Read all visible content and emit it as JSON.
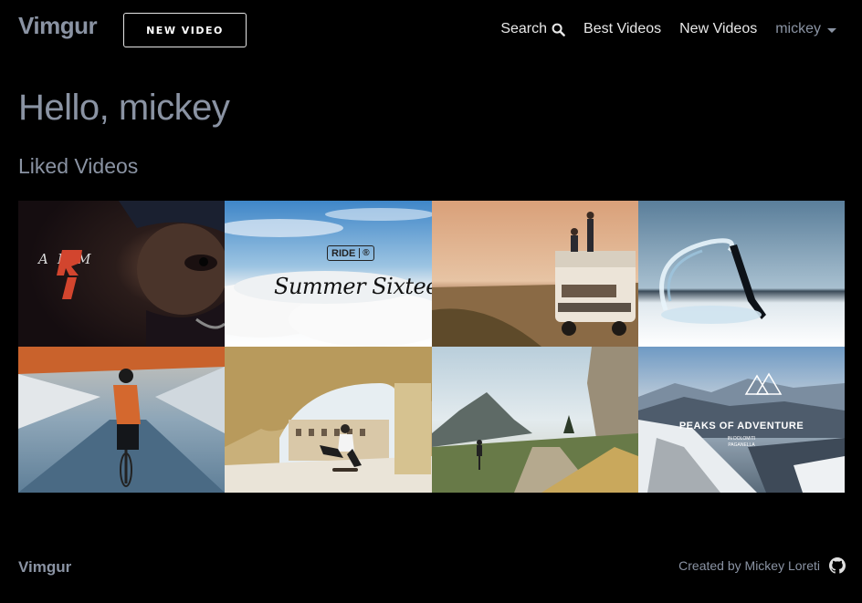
{
  "navbar": {
    "brand": "Vimgur",
    "new_video_label": "NEW VIDEO",
    "links": {
      "search": "Search",
      "best": "Best Videos",
      "new": "New Videos",
      "user": "mickey"
    }
  },
  "main": {
    "greeting": "Hello, mickey",
    "section_title": "Liked Videos"
  },
  "videos": [
    {
      "thumb_text": "ARM",
      "thumb_digit": "1"
    },
    {
      "thumb_badge": "RIDE",
      "thumb_badge_mark": "®",
      "thumb_script": "Summer Sixteen"
    },
    {},
    {},
    {},
    {},
    {},
    {
      "thumb_title": "PEAKS OF ADVENTURE",
      "thumb_sub1": "IN DOLOMITI",
      "thumb_sub2": "PAGANELLA"
    }
  ],
  "footer": {
    "brand": "Vimgur",
    "credit": "Created by Mickey Loreti"
  },
  "icons": {
    "search": "search-icon",
    "caret": "caret-down-icon",
    "github": "github-icon"
  },
  "colors": {
    "background": "#000000",
    "muted_text": "#8a93a3",
    "light_text": "#e8e8e8"
  }
}
